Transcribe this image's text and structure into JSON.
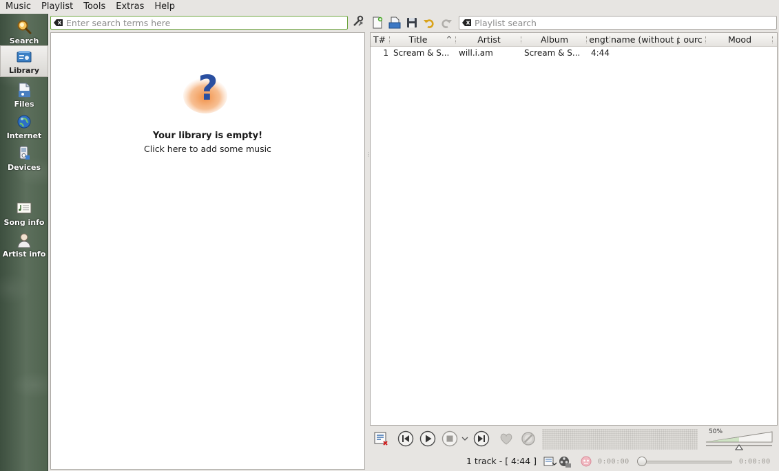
{
  "menu": [
    "Music",
    "Playlist",
    "Tools",
    "Extras",
    "Help"
  ],
  "sidebar": {
    "items": [
      {
        "label": "Search",
        "icon": "magnifier-icon"
      },
      {
        "label": "Library",
        "icon": "library-icon",
        "active": true
      },
      {
        "label": "Files",
        "icon": "files-icon"
      },
      {
        "label": "Internet",
        "icon": "globe-icon"
      },
      {
        "label": "Devices",
        "icon": "device-icon"
      },
      {
        "label": "Song info",
        "icon": "song-info-icon"
      },
      {
        "label": "Artist info",
        "icon": "artist-icon"
      }
    ]
  },
  "library": {
    "search_placeholder": "Enter search terms here",
    "empty_title": "Your library is empty!",
    "empty_subtitle": "Click here to add some music"
  },
  "playlist": {
    "search_placeholder": "Playlist search",
    "columns": [
      "T#",
      "Title",
      "Artist",
      "Album",
      "engt",
      "name (without p",
      "ourc",
      "Mood"
    ],
    "rows": [
      {
        "track": "1",
        "title": "Scream & S...",
        "artist": "will.i.am",
        "album": "Scream & S...",
        "length": "4:44"
      }
    ]
  },
  "player": {
    "volume_label": "50%",
    "volume_level": 0.5
  },
  "status": {
    "track_count": "1 track - [ 4:44 ]",
    "elapsed": "0:00:00",
    "remaining": "0:00:00"
  },
  "colors": {
    "accent_green": "#6aa33b",
    "sidebar": "#4f624f",
    "question_blue": "#2a4fa0",
    "question_orange": "#f08a3c"
  }
}
